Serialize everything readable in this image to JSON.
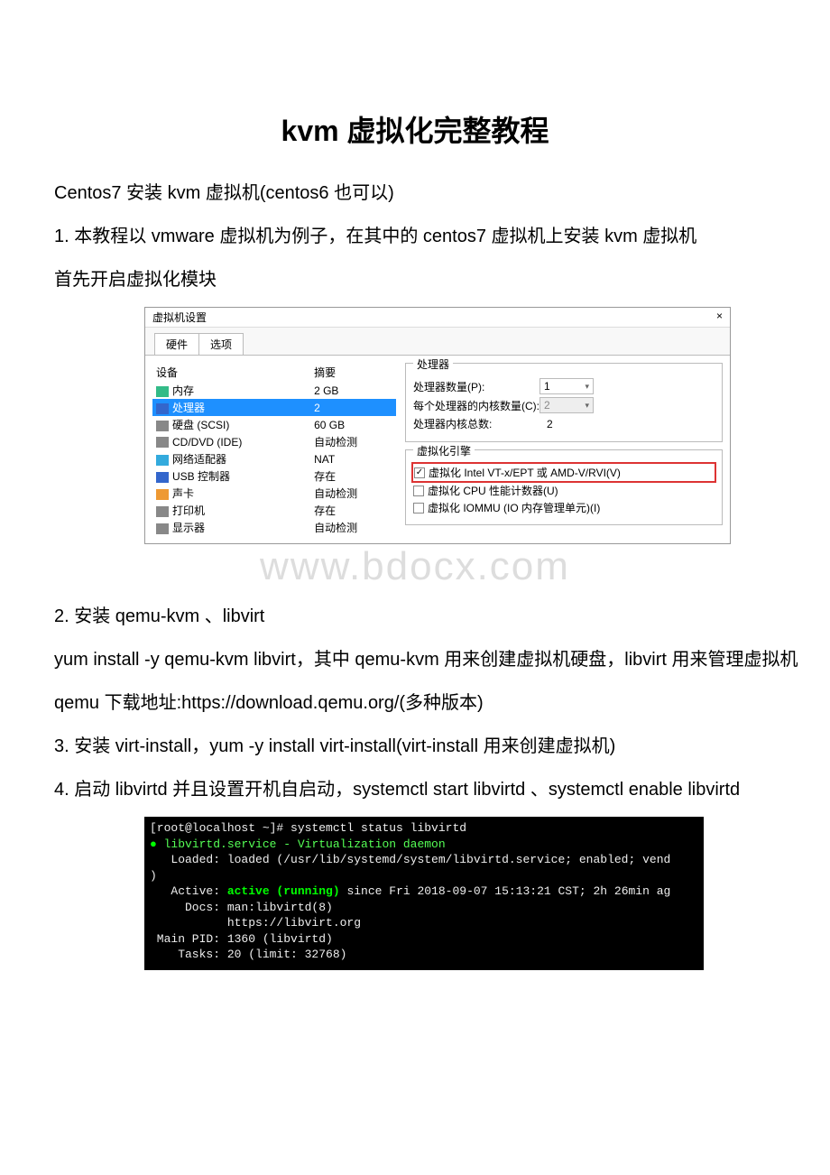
{
  "doc": {
    "title": "kvm 虚拟化完整教程",
    "p1": "Centos7 安装 kvm 虚拟机(centos6 也可以)",
    "p2": "1. 本教程以 vmware 虚拟机为例子，在其中的 centos7 虚拟机上安装 kvm 虚拟机",
    "p3": "首先开启虚拟化模块",
    "p4": "2. 安装 qemu-kvm 、libvirt",
    "p5": "yum install -y qemu-kvm libvirt，其中 qemu-kvm 用来创建虚拟机硬盘，libvirt 用来管理虚拟机",
    "p6": "qemu 下载地址:https://download.qemu.org/(多种版本)",
    "p7": "3. 安装 virt-install，yum -y install virt-install(virt-install 用来创建虚拟机)",
    "p8": "4. 启动 libvirtd 并且设置开机自启动，systemctl start libvirtd 、systemctl enable libvirtd"
  },
  "watermark": "www.bdocx.com",
  "vm": {
    "window_title": "虚拟机设置",
    "close_glyph": "×",
    "tabs": {
      "t0": "硬件",
      "t1": "选项"
    },
    "cols": {
      "device": "设备",
      "summary": "摘要"
    },
    "rows": {
      "mem": {
        "name": "内存",
        "val": "2 GB"
      },
      "cpu": {
        "name": "处理器",
        "val": "2"
      },
      "hdd": {
        "name": "硬盘 (SCSI)",
        "val": "60 GB"
      },
      "cd": {
        "name": "CD/DVD (IDE)",
        "val": "自动检测"
      },
      "net": {
        "name": "网络适配器",
        "val": "NAT"
      },
      "usb": {
        "name": "USB 控制器",
        "val": "存在"
      },
      "snd": {
        "name": "声卡",
        "val": "自动检测"
      },
      "prn": {
        "name": "打印机",
        "val": "存在"
      },
      "disp": {
        "name": "显示器",
        "val": "自动检测"
      }
    },
    "cpu_panel": {
      "title": "处理器",
      "count_label": "处理器数量(P):",
      "count_val": "1",
      "cores_label": "每个处理器的内核数量(C):",
      "cores_val": "2",
      "total_label": "处理器内核总数:",
      "total_val": "2"
    },
    "engine_panel": {
      "title": "虚拟化引擎",
      "vt": "虚拟化 Intel VT-x/EPT 或 AMD-V/RVI(V)",
      "pmu": "虚拟化 CPU 性能计数器(U)",
      "iommu": "虚拟化 IOMMU (IO 内存管理单元)(I)"
    }
  },
  "term": {
    "l1": "[root@localhost ~]# systemctl status libvirtd",
    "l2_a": "●",
    "l2_b": " libvirtd.service - Virtualization daemon",
    "l3": "   Loaded: loaded (/usr/lib/systemd/system/libvirtd.service; enabled; vend",
    "l3b": ")",
    "l4_a": "   Active: ",
    "l4_b": "active (running)",
    "l4_c": " since Fri 2018-09-07 15:13:21 CST; 2h 26min ag",
    "l5": "     Docs: man:libvirtd(8)",
    "l6": "           https://libvirt.org",
    "l7": " Main PID: 1360 (libvirtd)",
    "l8": "    Tasks: 20 (limit: 32768)"
  }
}
